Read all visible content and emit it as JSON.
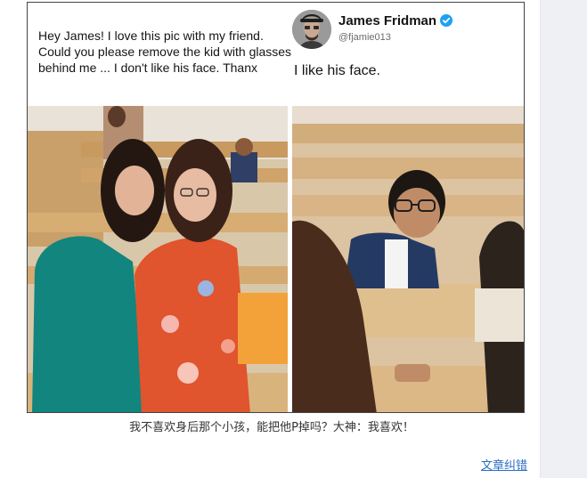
{
  "post": {
    "request_text": "Hey James! I love this pic with my friend. Could you please remove the kid with glasses behind me ... I don't like his face. Thanx",
    "author_name": "James Fridman",
    "author_handle": "@fjamie013",
    "reply_text": "I like his face."
  },
  "caption": "我不喜欢身后那个小孩，能把他P掉吗？大神：我喜欢！",
  "footer": {
    "report_link": "文章纠错"
  },
  "colors": {
    "link": "#2b6ec5",
    "verified_badge": "#1da1f2"
  }
}
